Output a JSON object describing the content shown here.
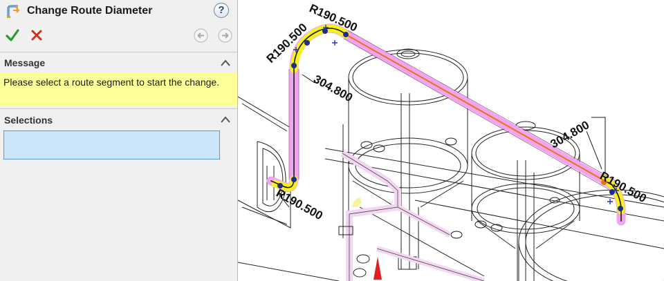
{
  "panel": {
    "title": "Change Route Diameter",
    "help_label": "?",
    "actions": {
      "ok_icon": "check-icon",
      "cancel_icon": "cross-icon"
    },
    "nav": {
      "back_icon": "arrow-left-icon",
      "forward_icon": "arrow-right-icon"
    },
    "message_section": {
      "title": "Message",
      "text": "Please select a route segment to start the change."
    },
    "selections_section": {
      "title": "Selections",
      "value": ""
    }
  },
  "viewport": {
    "dimensions": {
      "top_left_radius": "R190.500",
      "top_radius": "R190.500",
      "bottom_radius": "R190.500",
      "right_radius": "R190.500",
      "vertical_length": "304.800",
      "diagonal_length": "304.800"
    }
  },
  "colors": {
    "panel_bg": "#f0f0f0",
    "message_bg": "#ffff99",
    "selection_bg": "#cce4f7",
    "selection_border": "#5b9bd5",
    "route_pipe": "#f2a5ef",
    "route_highlight": "#f6f01e",
    "centerline": "#e8731a",
    "ok": "#2e9a2e",
    "cancel": "#d42a1a"
  }
}
